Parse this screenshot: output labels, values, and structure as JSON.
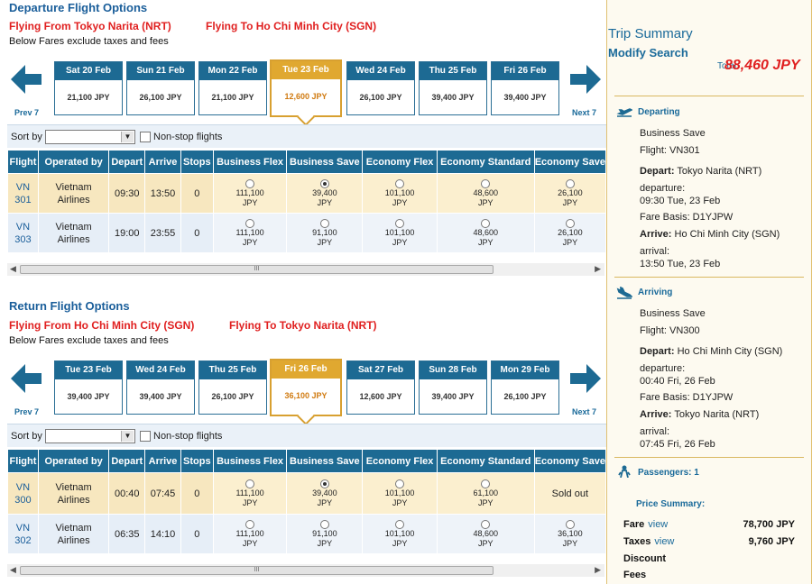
{
  "departure": {
    "section_title": "Departure Flight Options",
    "flying_from": "Flying From Tokyo Narita (NRT)",
    "flying_to": "Flying To Ho Chi Minh City (SGN)",
    "fare_note": "Below Fares exclude taxes and fees",
    "prev_label": "Prev 7",
    "next_label": "Next 7",
    "dates": [
      {
        "day": "Sat 20 Feb",
        "price": "21,100 JPY"
      },
      {
        "day": "Sun 21 Feb",
        "price": "26,100 JPY"
      },
      {
        "day": "Mon 22 Feb",
        "price": "21,100 JPY"
      },
      {
        "day": "Tue 23 Feb",
        "price": "12,600 JPY"
      },
      {
        "day": "Wed 24 Feb",
        "price": "26,100 JPY"
      },
      {
        "day": "Thu 25 Feb",
        "price": "39,400 JPY"
      },
      {
        "day": "Fri 26 Feb",
        "price": "39,400 JPY"
      }
    ],
    "sort_label": "Sort by",
    "nonstop_label": "Non-stop flights",
    "columns": [
      "Flight",
      "Operated by",
      "Depart",
      "Arrive",
      "Stops",
      "Business Flex",
      "Business Save",
      "Economy Flex",
      "Economy Standard",
      "Economy Save"
    ],
    "rows": [
      {
        "flight_a": "VN",
        "flight_b": "301",
        "op_a": "Vietnam",
        "op_b": "Airlines",
        "depart": "09:30",
        "arrive": "13:50",
        "stops": "0",
        "fares": [
          {
            "amt": "111,100",
            "cur": "JPY"
          },
          {
            "amt": "39,400",
            "cur": "JPY"
          },
          {
            "amt": "101,100",
            "cur": "JPY"
          },
          {
            "amt": "48,600",
            "cur": "JPY"
          },
          {
            "amt": "26,100",
            "cur": "JPY"
          }
        ]
      },
      {
        "flight_a": "VN",
        "flight_b": "303",
        "op_a": "Vietnam",
        "op_b": "Airlines",
        "depart": "19:00",
        "arrive": "23:55",
        "stops": "0",
        "fares": [
          {
            "amt": "111,100",
            "cur": "JPY"
          },
          {
            "amt": "91,100",
            "cur": "JPY"
          },
          {
            "amt": "101,100",
            "cur": "JPY"
          },
          {
            "amt": "48,600",
            "cur": "JPY"
          },
          {
            "amt": "26,100",
            "cur": "JPY"
          }
        ]
      }
    ]
  },
  "return": {
    "section_title": "Return Flight Options",
    "flying_from": "Flying From Ho Chi Minh City (SGN)",
    "flying_to": "Flying To Tokyo Narita (NRT)",
    "fare_note": "Below Fares exclude taxes and fees",
    "prev_label": "Prev 7",
    "next_label": "Next 7",
    "dates": [
      {
        "day": "Tue 23 Feb",
        "price": "39,400 JPY"
      },
      {
        "day": "Wed 24 Feb",
        "price": "39,400 JPY"
      },
      {
        "day": "Thu 25 Feb",
        "price": "26,100 JPY"
      },
      {
        "day": "Fri 26 Feb",
        "price": "36,100 JPY"
      },
      {
        "day": "Sat 27 Feb",
        "price": "12,600 JPY"
      },
      {
        "day": "Sun 28 Feb",
        "price": "39,400 JPY"
      },
      {
        "day": "Mon 29 Feb",
        "price": "26,100 JPY"
      }
    ],
    "sort_label": "Sort by",
    "nonstop_label": "Non-stop flights",
    "columns": [
      "Flight",
      "Operated by",
      "Depart",
      "Arrive",
      "Stops",
      "Business Flex",
      "Business Save",
      "Economy Flex",
      "Economy Standard",
      "Economy Save"
    ],
    "rows": [
      {
        "flight_a": "VN",
        "flight_b": "300",
        "op_a": "Vietnam",
        "op_b": "Airlines",
        "depart": "00:40",
        "arrive": "07:45",
        "stops": "0",
        "fares": [
          {
            "amt": "111,100",
            "cur": "JPY"
          },
          {
            "amt": "39,400",
            "cur": "JPY"
          },
          {
            "amt": "101,100",
            "cur": "JPY"
          },
          {
            "amt": "61,100",
            "cur": "JPY"
          }
        ],
        "sold_out": "Sold out"
      },
      {
        "flight_a": "VN",
        "flight_b": "302",
        "op_a": "Vietnam",
        "op_b": "Airlines",
        "depart": "06:35",
        "arrive": "14:10",
        "stops": "0",
        "fares": [
          {
            "amt": "111,100",
            "cur": "JPY"
          },
          {
            "amt": "91,100",
            "cur": "JPY"
          },
          {
            "amt": "101,100",
            "cur": "JPY"
          },
          {
            "amt": "48,600",
            "cur": "JPY"
          },
          {
            "amt": "36,100",
            "cur": "JPY"
          }
        ]
      }
    ]
  },
  "summary": {
    "title": "Trip Summary",
    "modify": "Modify Search",
    "total_label": "Total:",
    "total_value": "88,460 JPY",
    "departing": {
      "heading": "Departing",
      "fare_type": "Business Save",
      "flight": "Flight: VN301",
      "depart_label": "Depart:",
      "depart_value": "Tokyo Narita (NRT)",
      "departure_label": "departure:",
      "departure_time": "09:30 Tue, 23 Feb",
      "fare_basis": "Fare Basis: D1YJPW",
      "arrive_label": "Arrive:",
      "arrive_value": "Ho Chi Minh City (SGN)",
      "arrival_label": "arrival:",
      "arrival_time": "13:50 Tue, 23 Feb"
    },
    "arriving": {
      "heading": "Arriving",
      "fare_type": "Business Save",
      "flight": "Flight: VN300",
      "depart_label": "Depart:",
      "depart_value": "Ho Chi Minh City (SGN)",
      "departure_label": "departure:",
      "departure_time": "00:40 Fri, 26 Feb",
      "fare_basis": "Fare Basis: D1YJPW",
      "arrive_label": "Arrive:",
      "arrive_value": "Tokyo Narita (NRT)",
      "arrival_label": "arrival:",
      "arrival_time": "07:45 Fri, 26 Feb"
    },
    "passengers": "Passengers: 1",
    "price_summary": "Price Summary:",
    "fare_label": "Fare",
    "fare_link": "view",
    "fare_value": "78,700 JPY",
    "taxes_label": "Taxes",
    "taxes_link": "view",
    "taxes_value": "9,760 JPY",
    "discount_label": "Discount",
    "fees_label": "Fees"
  },
  "colors": {
    "accent": "#1d6a93",
    "selected": "#e0a830",
    "alert": "#e02020"
  }
}
